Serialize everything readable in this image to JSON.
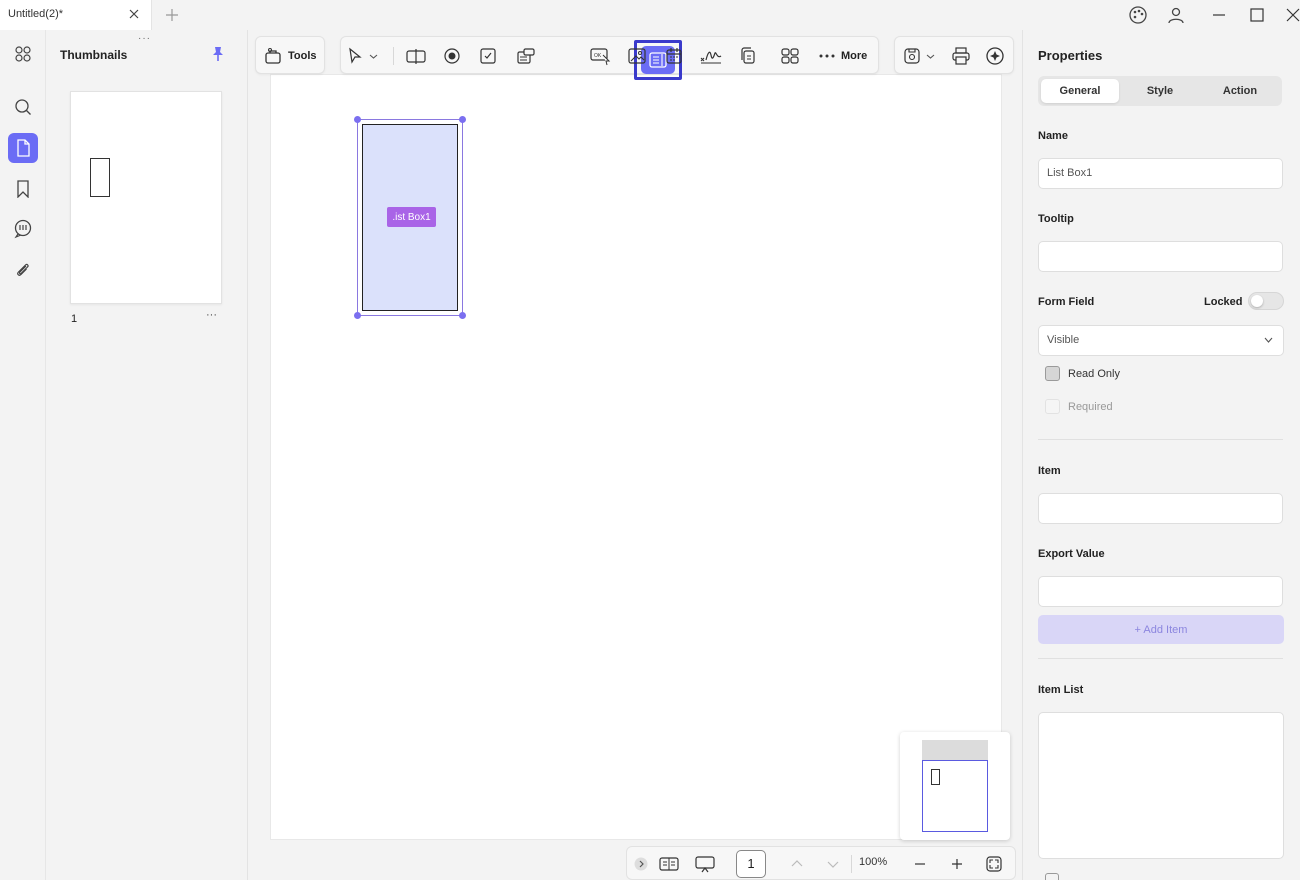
{
  "titlebar": {
    "tab_title": "Untitled(2)*"
  },
  "thumbnails": {
    "title": "Thumbnails",
    "grip": "···",
    "page_number": "1",
    "more": "···"
  },
  "toolbar": {
    "tools_label": "Tools",
    "more_label": "More"
  },
  "canvas": {
    "listbox_label": ".ist Box1"
  },
  "bottombar": {
    "page_value": "1",
    "zoom": "100%"
  },
  "properties": {
    "title": "Properties",
    "tabs": [
      "General",
      "Style",
      "Action"
    ],
    "active_tab": "General",
    "name_label": "Name",
    "name_value": "List Box1",
    "tooltip_label": "Tooltip",
    "tooltip_value": "",
    "form_field_label": "Form Field",
    "locked_label": "Locked",
    "locked": false,
    "visibility_value": "Visible",
    "read_only_label": "Read Only",
    "required_label": "Required",
    "item_label": "Item",
    "export_value_label": "Export Value",
    "add_item_label": "+ Add Item",
    "item_list_label": "Item List"
  },
  "colors": {
    "accent": "#6b6cf5",
    "selected_border": "#3a3acb",
    "listbox_fill": "#dbe1fb",
    "label_fill": "#a964e7"
  }
}
